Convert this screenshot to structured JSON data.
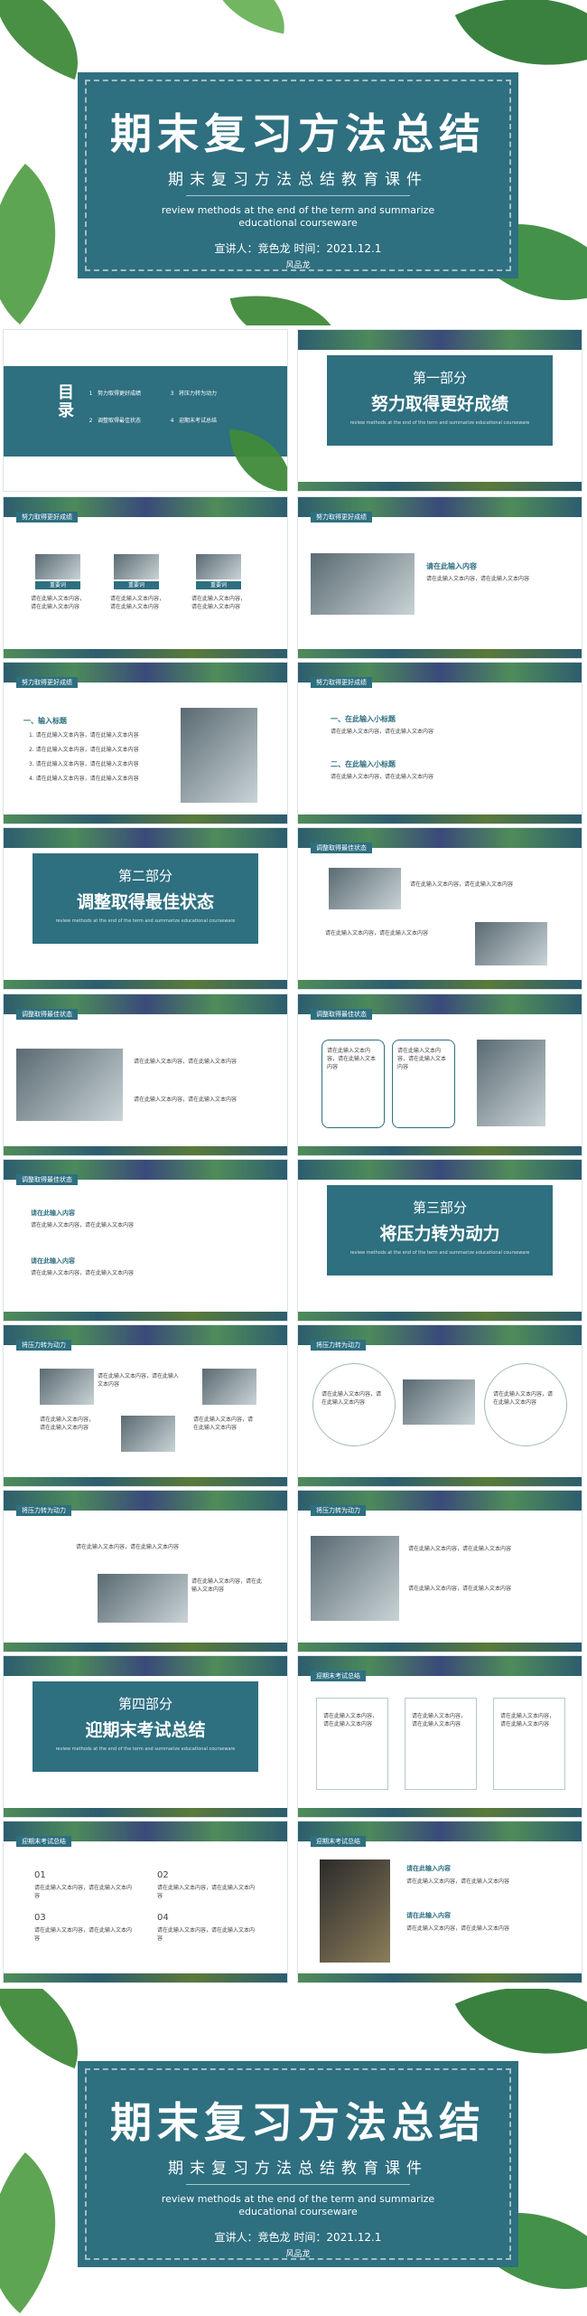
{
  "cover": {
    "title": "期末复习方法总结",
    "subtitle": "期末复习方法总结教育课件",
    "english": "review methods at the end of the term and summarize educational courseware",
    "speaker_line": "宣讲人：竞色龙   时间：2021.12.1",
    "logo": "风品龙"
  },
  "toc": {
    "title": "目录",
    "items": [
      {
        "num": "1",
        "label": "努力取得更好成绩"
      },
      {
        "num": "2",
        "label": "调整取得最佳状态"
      },
      {
        "num": "3",
        "label": "将压力转为动力"
      },
      {
        "num": "4",
        "label": "迎期末考试总结"
      }
    ]
  },
  "sections": [
    {
      "part": "第一部分",
      "title": "努力取得更好成绩",
      "en": "review methods at the end of the term and summarize educational courseware"
    },
    {
      "part": "第二部分",
      "title": "调整取得最佳状态",
      "en": "review methods at the end of the term and summarize educational courseware"
    },
    {
      "part": "第三部分",
      "title": "将压力转为动力",
      "en": "review methods at the end of the term and summarize educational courseware"
    },
    {
      "part": "第四部分",
      "title": "迎期末考试总结",
      "en": "review methods at the end of the term and summarize educational courseware"
    }
  ],
  "headers": {
    "s1": "努力取得更好成绩",
    "s2": "调整取得最佳状态",
    "s3": "将压力转为动力",
    "s4": "迎期末考试总结"
  },
  "text": {
    "input_content": "请在此输入内容",
    "click_text": "请在此输入文本内容，请在此输入文本内容",
    "keywords": "重要词",
    "sub1": "一、在此输入小标题",
    "sub2": "二、在此输入小标题",
    "title1": "一、输入标题",
    "nums": [
      "01",
      "02",
      "03",
      "04"
    ],
    "list": [
      "1. 请在此输入文本内容，请在此输入文本内容",
      "2. 请在此输入文本内容，请在此输入文本内容",
      "3. 请在此输入文本内容，请在此输入文本内容",
      "4. 请在此输入文本内容，请在此输入文本内容"
    ]
  }
}
